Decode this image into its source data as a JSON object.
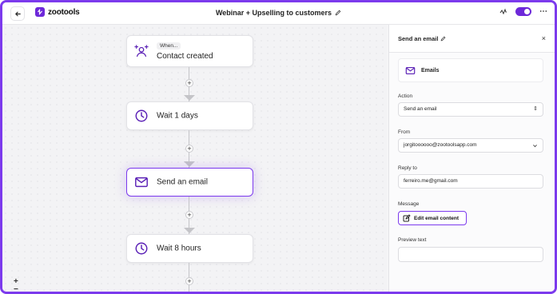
{
  "header": {
    "brand": "zootools",
    "title": "Webinar + Upselling to customers",
    "toggle_on": true,
    "accent": "#6d28d9"
  },
  "canvas": {
    "nodes": [
      {
        "pill": "When...",
        "label": "Contact created",
        "icon": "user-plus-icon"
      },
      {
        "label": "Wait 1 days",
        "icon": "clock-icon"
      },
      {
        "label": "Send an email",
        "icon": "mail-icon",
        "selected": true
      },
      {
        "label": "Wait 8 hours",
        "icon": "clock-icon"
      }
    ],
    "add_step": "+",
    "zoom_in": "+",
    "zoom_out": "−"
  },
  "panel": {
    "title": "Send an email",
    "close": "×",
    "app_name": "Emails",
    "action_label": "Action",
    "action_value": "Send an email",
    "from_label": "From",
    "from_value": "jorgitoooooo@zootoolsapp.com",
    "reply_label": "Reply to",
    "reply_value": "ferreiro.me@gmail.com",
    "message_label": "Message",
    "edit_button": "Edit email content",
    "preview_label": "Preview text",
    "preview_value": ""
  }
}
